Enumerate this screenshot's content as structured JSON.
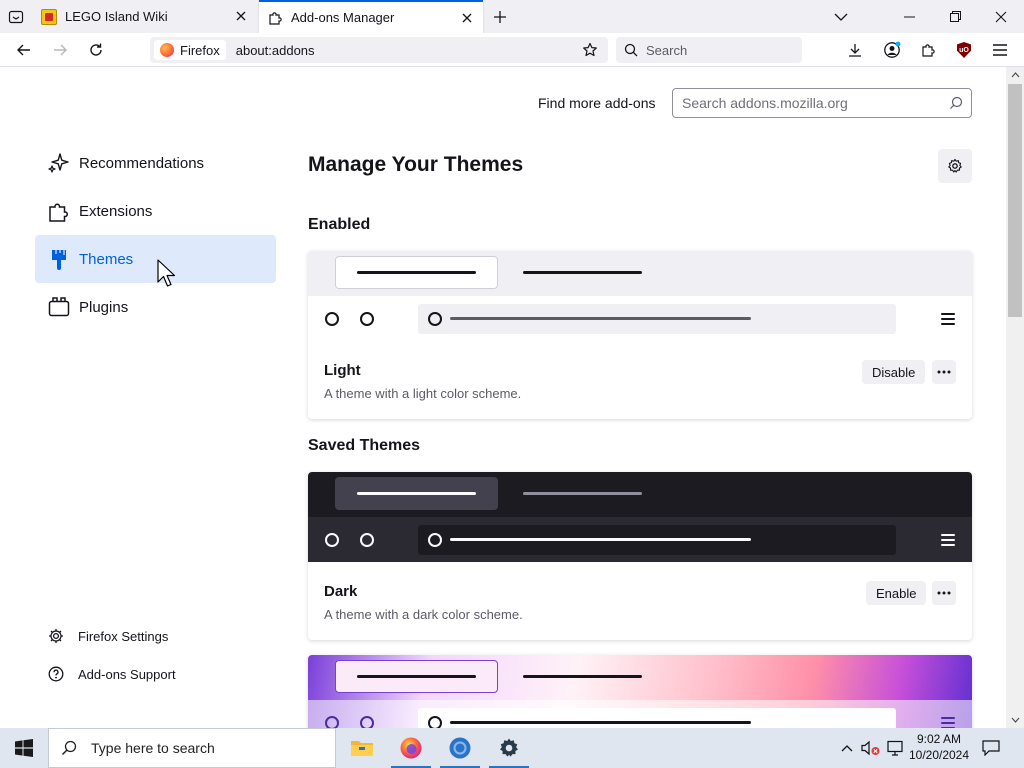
{
  "tabs": [
    {
      "title": "LEGO Island Wiki",
      "icon": "lego-favicon"
    },
    {
      "title": "Add-ons Manager",
      "icon": "puzzle-icon",
      "active": true
    }
  ],
  "navbar": {
    "identity_label": "Firefox",
    "url": "about:addons",
    "search_placeholder": "Search"
  },
  "addons": {
    "find_more_label": "Find more add-ons",
    "amo_search_placeholder": "Search addons.mozilla.org",
    "categories": [
      {
        "label": "Recommendations",
        "icon": "sparkle-icon"
      },
      {
        "label": "Extensions",
        "icon": "puzzle-icon"
      },
      {
        "label": "Themes",
        "icon": "brush-icon",
        "selected": true
      },
      {
        "label": "Plugins",
        "icon": "plugin-icon"
      }
    ],
    "footer_links": [
      {
        "label": "Firefox Settings",
        "icon": "gear-icon"
      },
      {
        "label": "Add-ons Support",
        "icon": "help-icon"
      }
    ],
    "heading": "Manage Your Themes",
    "enabled_heading": "Enabled",
    "saved_heading": "Saved Themes",
    "themes": [
      {
        "name": "Light",
        "description": "A theme with a light color scheme.",
        "action": "Disable"
      },
      {
        "name": "Dark",
        "description": "A theme with a dark color scheme.",
        "action": "Enable"
      }
    ]
  },
  "taskbar": {
    "search_placeholder": "Type here to search",
    "time": "9:02 AM",
    "date": "10/20/2024"
  },
  "colors": {
    "accent": "#0061e0",
    "selected_bg": "#deeafc",
    "dark_theme_bg": "#1c1b22"
  }
}
